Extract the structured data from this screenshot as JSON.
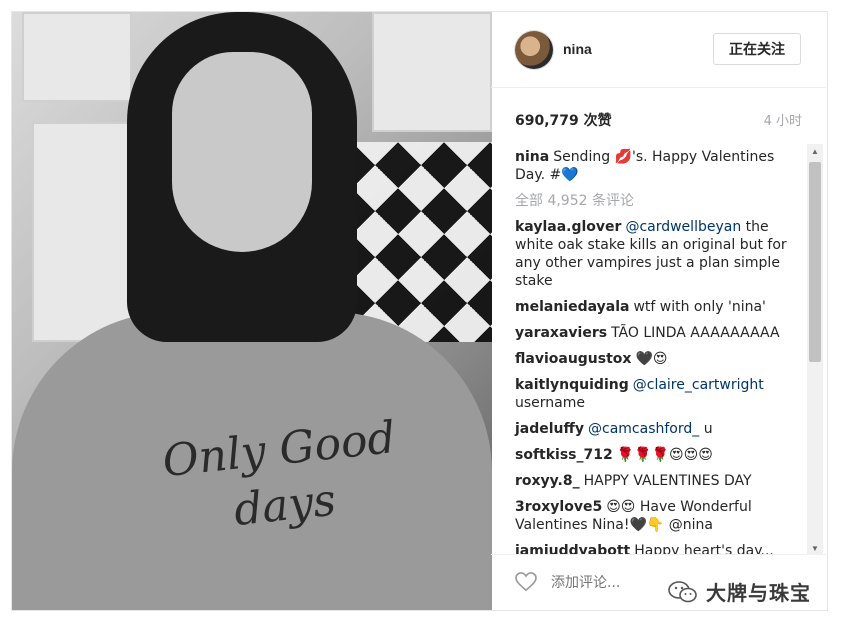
{
  "post": {
    "username": "nina",
    "follow_label": "正在关注",
    "likes": "690,779 次赞",
    "time": "4 小时",
    "shirt_text": "Only Good days"
  },
  "caption": {
    "user": "nina",
    "text": "Sending 💋's. Happy Valentines Day. #💙"
  },
  "view_all_comments": "全部 4,952 条评论",
  "comments": [
    {
      "user": "kaylaa.glover",
      "mention": "@cardwellbeyan",
      "text": " the white oak stake kills an original but for any other vampires just a plan simple stake"
    },
    {
      "user": "melaniedayala",
      "mention": "",
      "text": "wtf with only 'nina'"
    },
    {
      "user": "yaraxaviers",
      "mention": "",
      "text": "TÃO LINDA AAAAAAAAA"
    },
    {
      "user": "flavioaugustox",
      "mention": "",
      "text": "🖤😍"
    },
    {
      "user": "kaitlynquiding",
      "mention": "@claire_cartwright",
      "text": " username"
    },
    {
      "user": "jadeluffy",
      "mention": "@camcashford_",
      "text": " u"
    },
    {
      "user": "softkiss_712",
      "mention": "",
      "text": "🌹🌹🌹😍😍😍"
    },
    {
      "user": "roxyy.8_",
      "mention": "",
      "text": "HAPPY VALENTINES DAY"
    },
    {
      "user": "3roxylove5",
      "mention": "",
      "text": "😍😍 Have Wonderful Valentines Nina!🖤👇 @nina"
    },
    {
      "user": "iamjuddyabott",
      "mention": "",
      "text": "Happy heart's day..."
    },
    {
      "user": "",
      "mention": "",
      "text": "🖤🖤🖤"
    }
  ],
  "footer": {
    "comment_placeholder": "添加评论..."
  },
  "watermark": {
    "text": "大牌与珠宝"
  }
}
